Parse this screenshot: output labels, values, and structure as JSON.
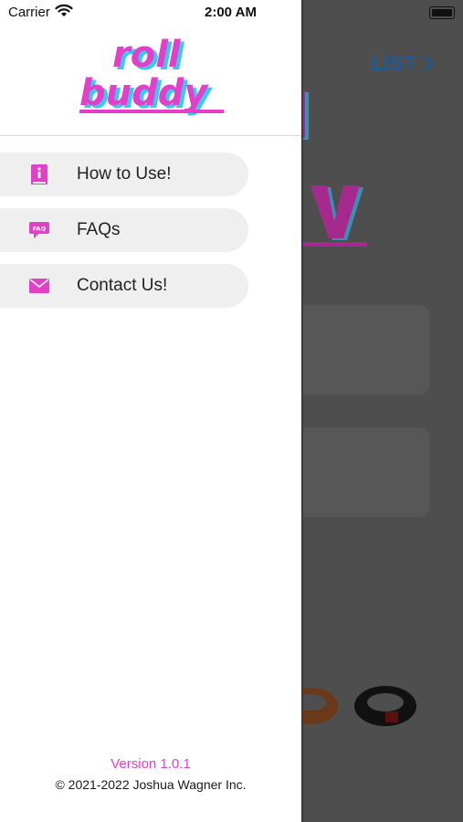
{
  "status_bar": {
    "carrier": "Carrier",
    "time": "2:00 AM"
  },
  "drawer": {
    "logo_text": [
      "roll",
      "buddy"
    ],
    "menu": [
      {
        "label": "How to Use!",
        "icon": "info-book-icon"
      },
      {
        "label": "FAQs",
        "icon": "faq-bubble-icon"
      },
      {
        "label": "Contact Us!",
        "icon": "mail-icon"
      }
    ],
    "version": "Version 1.0.1",
    "copyright": "© 2021-2022 Joshua Wagner Inc."
  },
  "background": {
    "list_label": "LIST"
  },
  "colors": {
    "accent": "#e43fc8",
    "logo_shadow": "#37c9f0",
    "menu_bg": "#efeff0",
    "overlay": "#4e4e4e",
    "link": "#1f5a92"
  }
}
